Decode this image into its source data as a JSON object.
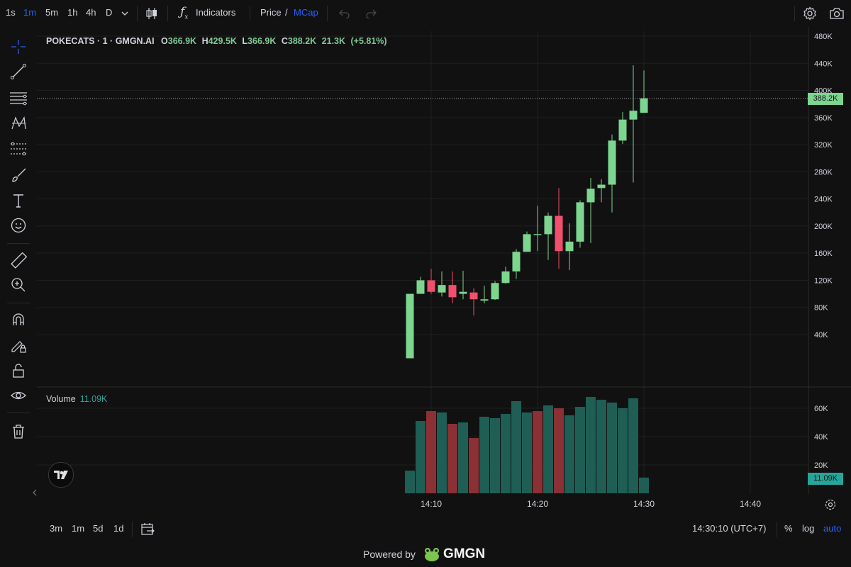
{
  "toolbar": {
    "timeframes": [
      "1s",
      "1m",
      "5m",
      "1h",
      "4h",
      "D"
    ],
    "active_timeframe": "1m",
    "indicators_label": "Indicators",
    "price_label": "Price",
    "slash": "/",
    "mcap_label": "MCap"
  },
  "legend": {
    "title": "POKECATS · 1 · GMGN.AI",
    "open_label": "O",
    "open": "366.9K",
    "high_label": "H",
    "high": "429.5K",
    "low_label": "L",
    "low": "366.9K",
    "close_label": "C",
    "close": "388.2K",
    "volume": "21.3K",
    "change": "(+5.81%)"
  },
  "volume_legend": {
    "label": "Volume",
    "value": "11.09K"
  },
  "price_tag": "388.2K",
  "volume_tag": "11.09K",
  "timezone_readout": "14:30:10 (UTC+7)",
  "bottom": {
    "ranges": [
      "3m",
      "1m",
      "5d",
      "1d"
    ],
    "percent": "%",
    "log": "log",
    "auto": "auto"
  },
  "powered": {
    "prefix": "Powered by",
    "brand": "GMGN"
  },
  "colors": {
    "up": "#7dd68f",
    "down": "#f0506e",
    "vol_up": "#1e5e55",
    "vol_down": "#8b3035",
    "accent": "#2962ff",
    "bg": "#111111"
  },
  "chart_data": {
    "type": "candlestick",
    "price_axis_ticks": [
      "480K",
      "440K",
      "400K",
      "360K",
      "320K",
      "280K",
      "240K",
      "200K",
      "160K",
      "120K",
      "80K",
      "40K"
    ],
    "volume_axis_ticks": [
      "60K",
      "40K",
      "20K"
    ],
    "time_ticks": [
      "14:10",
      "14:20",
      "14:30",
      "14:40"
    ],
    "candles": [
      {
        "t": "14:09",
        "o": 5,
        "h": 100,
        "l": 5,
        "c": 100
      },
      {
        "t": "14:10",
        "o": 100,
        "h": 125,
        "l": 100,
        "c": 120
      },
      {
        "t": "14:11",
        "o": 120,
        "h": 137,
        "l": 100,
        "c": 103
      },
      {
        "t": "14:12",
        "o": 102,
        "h": 133,
        "l": 96,
        "c": 113
      },
      {
        "t": "14:13",
        "o": 113,
        "h": 133,
        "l": 86,
        "c": 95
      },
      {
        "t": "14:14",
        "o": 100,
        "h": 134,
        "l": 92,
        "c": 103
      },
      {
        "t": "14:15",
        "o": 102,
        "h": 108,
        "l": 68,
        "c": 92
      },
      {
        "t": "14:16",
        "o": 90,
        "h": 112,
        "l": 86,
        "c": 92
      },
      {
        "t": "14:17",
        "o": 92,
        "h": 119,
        "l": 91,
        "c": 116
      },
      {
        "t": "14:18",
        "o": 116,
        "h": 140,
        "l": 115,
        "c": 133
      },
      {
        "t": "14:19",
        "o": 133,
        "h": 166,
        "l": 122,
        "c": 162
      },
      {
        "t": "14:20",
        "o": 162,
        "h": 192,
        "l": 162,
        "c": 188
      },
      {
        "t": "14:21",
        "o": 188,
        "h": 230,
        "l": 163,
        "c": 188
      },
      {
        "t": "14:22",
        "o": 188,
        "h": 220,
        "l": 150,
        "c": 215
      },
      {
        "t": "14:23",
        "o": 215,
        "h": 256,
        "l": 137,
        "c": 163
      },
      {
        "t": "14:24",
        "o": 163,
        "h": 204,
        "l": 135,
        "c": 177
      },
      {
        "t": "14:25",
        "o": 177,
        "h": 238,
        "l": 168,
        "c": 235
      },
      {
        "t": "14:26",
        "o": 235,
        "h": 271,
        "l": 175,
        "c": 255
      },
      {
        "t": "14:27",
        "o": 256,
        "h": 269,
        "l": 235,
        "c": 261
      },
      {
        "t": "14:28",
        "o": 261,
        "h": 335,
        "l": 220,
        "c": 326
      },
      {
        "t": "14:29",
        "o": 326,
        "h": 368,
        "l": 321,
        "c": 357
      },
      {
        "t": "14:30",
        "o": 357,
        "h": 437,
        "l": 264,
        "c": 370
      },
      {
        "t": "14:31",
        "o": 366.9,
        "h": 429.5,
        "l": 366.9,
        "c": 388.2
      }
    ],
    "volumes": [
      16,
      51,
      58,
      57,
      49,
      50,
      39,
      54,
      53,
      56,
      65,
      57,
      58,
      62,
      60,
      55,
      61,
      68,
      66,
      64,
      60,
      67,
      11.09
    ],
    "volume_up": [
      true,
      true,
      false,
      true,
      false,
      true,
      false,
      true,
      true,
      true,
      true,
      true,
      false,
      true,
      false,
      true,
      true,
      true,
      true,
      true,
      true,
      true,
      true
    ],
    "last_price": 388.2,
    "y_range_k": [
      0,
      480
    ],
    "grid": true
  }
}
